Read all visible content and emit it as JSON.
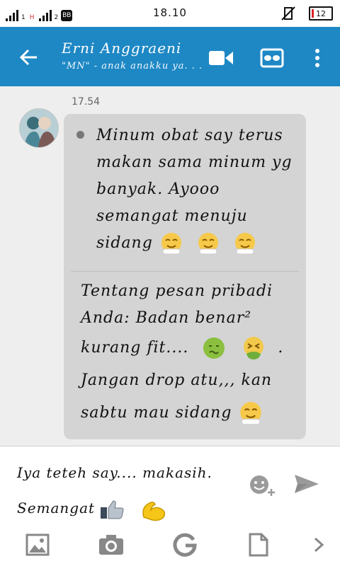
{
  "status_bar": {
    "time": "18.10",
    "sim1": "1",
    "sim2": "2",
    "network": "H",
    "bbm": "BB",
    "battery": "12"
  },
  "app_bar": {
    "title": "Erni Anggraeni",
    "subtitle": "\"MN\" - anak anakku ya. . ."
  },
  "chat": {
    "timestamp": "17.54",
    "message1": "Minum obat say terus makan sama minum yg banyak. Ayooo semangat menuju sidang",
    "message2_line1": "Tentang pesan pribadi Anda: Badan benar²",
    "message2_line2": "kurang fit....",
    "message2_line3": "Jangan drop atu,,, kan",
    "message2_line4": "sabtu mau sidang"
  },
  "input": {
    "line1": "Iya teteh say.... makasih.",
    "line2": "Semangat"
  },
  "colors": {
    "app_bar": "#1e88c5",
    "bubble": "#d4d4d4",
    "background": "#eeeeee"
  },
  "icons": {
    "back": "arrow-left-icon",
    "video": "video-call-icon",
    "mask": "mask-icon",
    "more": "more-vert-icon",
    "emoji": "emoji-add-icon",
    "send": "send-icon",
    "toolbar": [
      "image-icon",
      "camera-icon",
      "google-icon",
      "file-icon",
      "chevron-right-icon"
    ]
  }
}
